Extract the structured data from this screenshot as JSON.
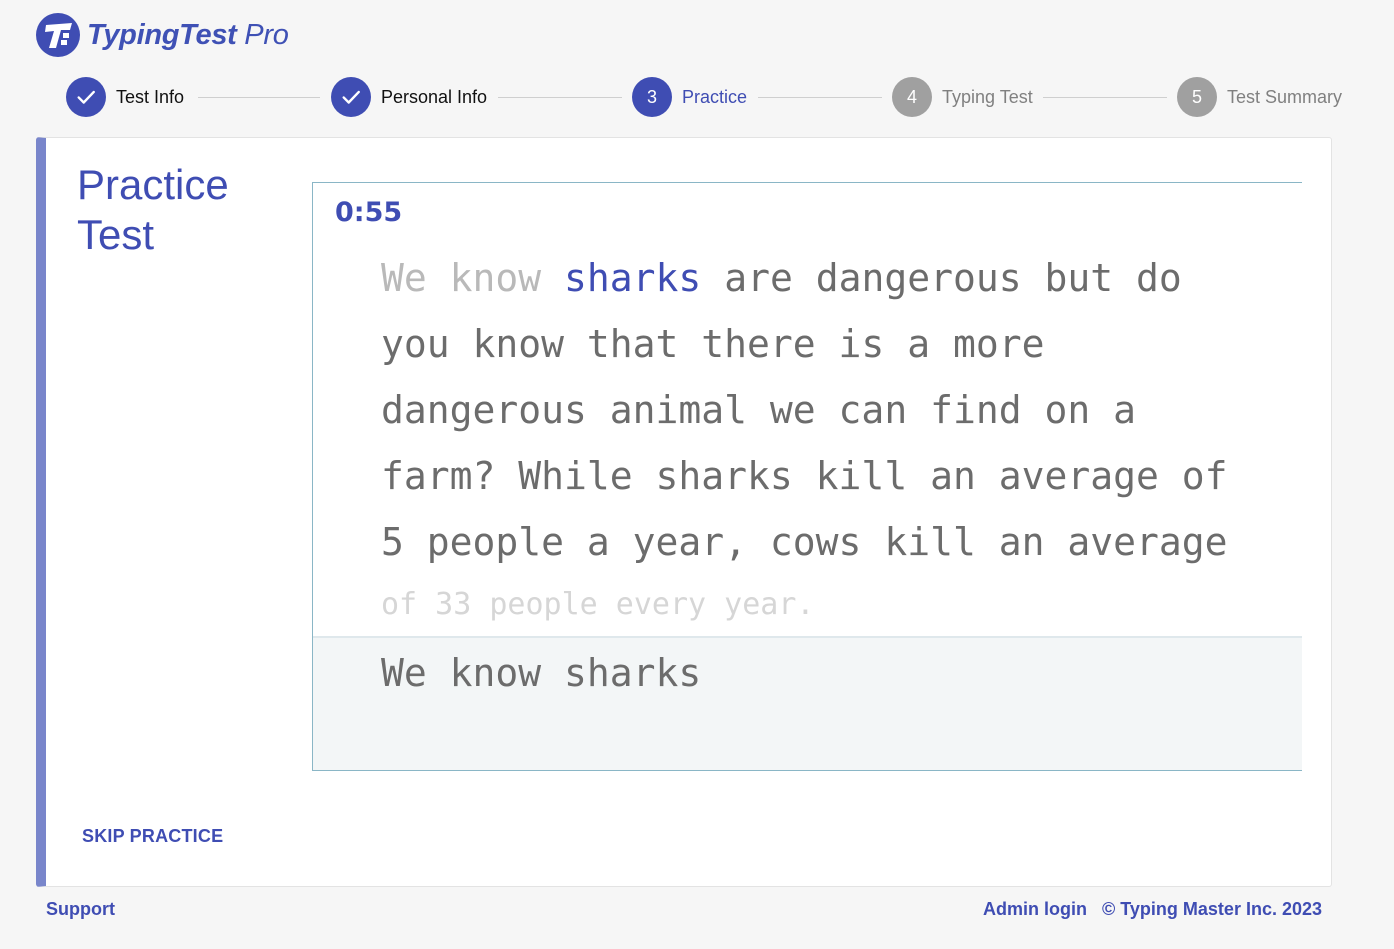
{
  "brand": {
    "logo_icon": "typing-t-icon",
    "name_bold": "TypingTest",
    "name_light": " Pro",
    "accent_color": "#3f4db3"
  },
  "stepper": {
    "steps": [
      {
        "label": "Test Info",
        "number": "1",
        "status": "done"
      },
      {
        "label": "Personal Info",
        "number": "2",
        "status": "done"
      },
      {
        "label": "Practice",
        "number": "3",
        "status": "active"
      },
      {
        "label": "Typing Test",
        "number": "4",
        "status": "todo"
      },
      {
        "label": "Test Summary",
        "number": "5",
        "status": "todo"
      }
    ]
  },
  "card": {
    "title_line1": "Practice",
    "title_line2": "Test",
    "skip_label": "SKIP PRACTICE"
  },
  "practice": {
    "timer": "0:55",
    "line1_typed": "We know ",
    "line1_current": "sharks",
    "line1_rest": " are dangerous but do",
    "line2": "you know that there is a more",
    "line3": "dangerous animal we can find on a",
    "line4": "farm? While sharks kill an average of",
    "line5": "5 people a year, cows kill an average",
    "line6": "of 33 people every year.",
    "input_value": "We know sharks"
  },
  "footer": {
    "support_label": "Support",
    "admin_label": "Admin login",
    "copyright": "© Typing Master Inc. 2023"
  }
}
